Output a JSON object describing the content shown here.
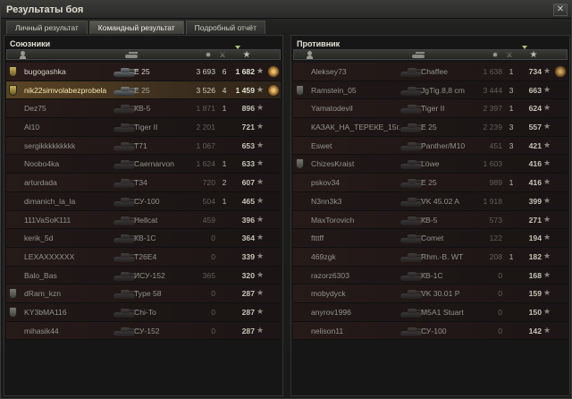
{
  "window": {
    "title": "Результаты боя",
    "close_label": "✕"
  },
  "tabs": [
    {
      "label": "Личный результат",
      "active": false
    },
    {
      "label": "Командный результат",
      "active": true
    },
    {
      "label": "Подробный отчёт",
      "active": false
    }
  ],
  "allies": {
    "title": "Союзники",
    "rows": [
      {
        "player": "bugogashka",
        "tank": "E 25",
        "damage": "3 693",
        "kills": "6",
        "xp": "1 682",
        "clan": true,
        "clan_color": "gold",
        "alive": true,
        "me": false,
        "medal": true
      },
      {
        "player": "nik22simvolabezprobela",
        "tank": "E 25",
        "damage": "3 526",
        "kills": "4",
        "xp": "1 459",
        "clan": true,
        "clan_color": "gold",
        "alive": true,
        "me": true,
        "medal": true
      },
      {
        "player": "Dez75",
        "tank": "КВ-5",
        "damage": "1 871",
        "kills": "1",
        "xp": "896",
        "clan": false,
        "alive": false,
        "me": false,
        "medal": false
      },
      {
        "player": "Al10",
        "tank": "Tiger II",
        "damage": "2 201",
        "kills": "",
        "xp": "721",
        "clan": false,
        "alive": false,
        "me": false,
        "medal": false
      },
      {
        "player": "sergikkkkkkkkk",
        "tank": "T71",
        "damage": "1 067",
        "kills": "",
        "xp": "653",
        "clan": false,
        "alive": false,
        "me": false,
        "medal": false
      },
      {
        "player": "Noobo4ka",
        "tank": "Caernarvon",
        "damage": "1 624",
        "kills": "1",
        "xp": "633",
        "clan": false,
        "alive": false,
        "me": false,
        "medal": false
      },
      {
        "player": "arturdada",
        "tank": "T34",
        "damage": "720",
        "kills": "2",
        "xp": "607",
        "clan": false,
        "alive": false,
        "me": false,
        "medal": false
      },
      {
        "player": "dimanich_la_la",
        "tank": "СУ-100",
        "damage": "504",
        "kills": "1",
        "xp": "465",
        "clan": false,
        "alive": false,
        "me": false,
        "medal": false
      },
      {
        "player": "111VaSoK111",
        "tank": "Hellcat",
        "damage": "459",
        "kills": "",
        "xp": "396",
        "clan": false,
        "alive": false,
        "me": false,
        "medal": false
      },
      {
        "player": "kerik_5d",
        "tank": "КВ-1С",
        "damage": "0",
        "kills": "",
        "xp": "364",
        "clan": false,
        "alive": false,
        "me": false,
        "medal": false
      },
      {
        "player": "LEXAXXXXXX",
        "tank": "T26E4",
        "damage": "0",
        "kills": "",
        "xp": "339",
        "clan": false,
        "alive": false,
        "me": false,
        "medal": false
      },
      {
        "player": "Balo_Bas",
        "tank": "ИСУ-152",
        "damage": "365",
        "kills": "",
        "xp": "320",
        "clan": false,
        "alive": false,
        "me": false,
        "medal": false
      },
      {
        "player": "dRam_kzn",
        "tank": "Type 58",
        "damage": "0",
        "kills": "",
        "xp": "287",
        "clan": true,
        "clan_color": "gray",
        "alive": false,
        "me": false,
        "medal": false
      },
      {
        "player": "KY3bMA116",
        "tank": "Chi-To",
        "damage": "0",
        "kills": "",
        "xp": "287",
        "clan": true,
        "clan_color": "gray",
        "alive": false,
        "me": false,
        "medal": false
      },
      {
        "player": "mihasik44",
        "tank": "СУ-152",
        "damage": "0",
        "kills": "",
        "xp": "287",
        "clan": false,
        "alive": false,
        "me": false,
        "medal": false
      }
    ]
  },
  "enemies": {
    "title": "Противник",
    "rows": [
      {
        "player": "Aleksey73",
        "tank": "Chaffee",
        "damage": "1 638",
        "kills": "1",
        "xp": "734",
        "clan": false,
        "alive": false,
        "me": false,
        "medal": true
      },
      {
        "player": "Ramstein_05",
        "tank": "JgTig.8,8 cm",
        "damage": "3 444",
        "kills": "3",
        "xp": "663",
        "clan": true,
        "clan_color": "gray",
        "alive": false,
        "me": false,
        "medal": false
      },
      {
        "player": "Yamatodevil",
        "tank": "Tiger II",
        "damage": "2 397",
        "kills": "1",
        "xp": "624",
        "clan": false,
        "alive": false,
        "me": false,
        "medal": false
      },
      {
        "player": "КАЗАК_НА_ТЕРЕКЕ_15г.",
        "tank": "E 25",
        "damage": "2 239",
        "kills": "3",
        "xp": "557",
        "clan": false,
        "alive": false,
        "me": false,
        "medal": false
      },
      {
        "player": "Eswet",
        "tank": "Panther/M10",
        "damage": "451",
        "kills": "3",
        "xp": "421",
        "clan": false,
        "alive": false,
        "me": false,
        "medal": false
      },
      {
        "player": "ChizesKraist",
        "tank": "Löwe",
        "damage": "1 603",
        "kills": "",
        "xp": "416",
        "clan": true,
        "clan_color": "gray",
        "alive": false,
        "me": false,
        "medal": false
      },
      {
        "player": "pskov34",
        "tank": "E 25",
        "damage": "989",
        "kills": "1",
        "xp": "416",
        "clan": false,
        "alive": false,
        "me": false,
        "medal": false
      },
      {
        "player": "N3nn3k3",
        "tank": "VK 45.02 A",
        "damage": "1 918",
        "kills": "",
        "xp": "399",
        "clan": false,
        "alive": false,
        "me": false,
        "medal": false
      },
      {
        "player": "MaxTorovich",
        "tank": "КВ-5",
        "damage": "573",
        "kills": "",
        "xp": "271",
        "clan": false,
        "alive": false,
        "me": false,
        "medal": false
      },
      {
        "player": "ftttff",
        "tank": "Comet",
        "damage": "122",
        "kills": "",
        "xp": "194",
        "clan": false,
        "alive": false,
        "me": false,
        "medal": false
      },
      {
        "player": "469zgk",
        "tank": "Rhm.-B. WT",
        "damage": "208",
        "kills": "1",
        "xp": "182",
        "clan": false,
        "alive": false,
        "me": false,
        "medal": false
      },
      {
        "player": "razorz6303",
        "tank": "КВ-1С",
        "damage": "0",
        "kills": "",
        "xp": "168",
        "clan": false,
        "alive": false,
        "me": false,
        "medal": false
      },
      {
        "player": "mobydyck",
        "tank": "VK 30.01 P",
        "damage": "0",
        "kills": "",
        "xp": "159",
        "clan": false,
        "alive": false,
        "me": false,
        "medal": false
      },
      {
        "player": "anyrov1996",
        "tank": "M5A1 Stuart",
        "damage": "0",
        "kills": "",
        "xp": "150",
        "clan": false,
        "alive": false,
        "me": false,
        "medal": false
      },
      {
        "player": "nelison11",
        "tank": "СУ-100",
        "damage": "0",
        "kills": "",
        "xp": "142",
        "clan": false,
        "alive": false,
        "me": false,
        "medal": false
      }
    ]
  }
}
